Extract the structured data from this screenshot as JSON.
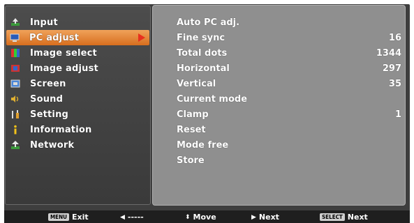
{
  "menu": {
    "items": [
      {
        "label": "Input",
        "icon": "input-icon"
      },
      {
        "label": "PC adjust",
        "icon": "pc-adjust-icon",
        "selected": true
      },
      {
        "label": "Image select",
        "icon": "image-select-icon"
      },
      {
        "label": "Image adjust",
        "icon": "image-adjust-icon"
      },
      {
        "label": "Screen",
        "icon": "screen-icon"
      },
      {
        "label": "Sound",
        "icon": "sound-icon"
      },
      {
        "label": "Setting",
        "icon": "setting-icon"
      },
      {
        "label": "Information",
        "icon": "information-icon"
      },
      {
        "label": "Network",
        "icon": "network-icon"
      }
    ]
  },
  "submenu": {
    "rows": [
      {
        "label": "Auto PC adj.",
        "value": ""
      },
      {
        "label": "Fine sync",
        "value": "16"
      },
      {
        "label": "Total dots",
        "value": "1344"
      },
      {
        "label": "Horizontal",
        "value": "297"
      },
      {
        "label": "Vertical",
        "value": "35"
      },
      {
        "label": "Current mode",
        "value": ""
      },
      {
        "label": "Clamp",
        "value": "1"
      },
      {
        "label": "Reset",
        "value": ""
      },
      {
        "label": "Mode free",
        "value": ""
      },
      {
        "label": "Store",
        "value": ""
      }
    ]
  },
  "footer": {
    "menu_key": "MENU",
    "exit_label": "Exit",
    "back_label": "-----",
    "move_label": "Move",
    "next_label": "Next",
    "select_key": "SELECT",
    "select_next_label": "Next"
  },
  "colors": {
    "selected_bg": "#e07d2c",
    "selected_arrow": "#e8301e",
    "submenu_bg": "#8f8f8f"
  }
}
